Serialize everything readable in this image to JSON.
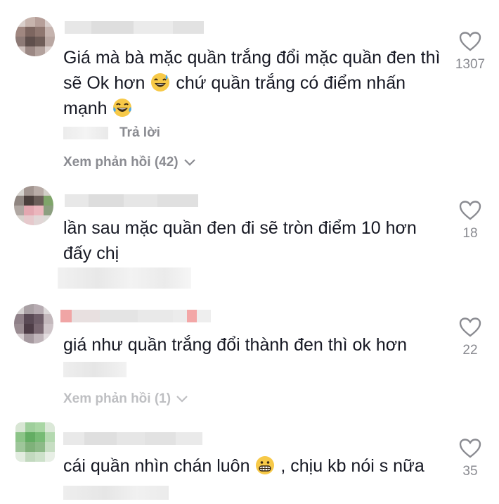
{
  "comments": [
    {
      "text_parts": [
        "Giá mà bà mặc quần trắng đổi mặc quần đen thì sẽ Ok hơn ",
        " chứ quần trắng có điểm nhấn mạnh "
      ],
      "emoji": [
        "grinning-sweat-emoji",
        "tears-of-joy-emoji"
      ],
      "reply_label": "Trả lời",
      "view_replies": "Xem phản hồi (42)",
      "likes": "1307",
      "heart_icon": "heart-outline-icon"
    },
    {
      "text": "lần sau mặc quần đen đi sẽ tròn điểm 10 hơn đấy chị",
      "likes": "18",
      "heart_icon": "heart-outline-icon"
    },
    {
      "text": "giá như quần trắng đổi thành đen thì ok hơn",
      "view_replies": "Xem phản hồi (1)",
      "likes": "22",
      "heart_icon": "heart-outline-icon"
    },
    {
      "text_parts": [
        "cái quần nhìn chán luôn ",
        " , chịu kb nói s nữa"
      ],
      "emoji": [
        "grimacing-emoji"
      ],
      "likes": "35",
      "heart_icon": "heart-outline-icon"
    }
  ],
  "colors": {
    "text": "#161823",
    "secondary": "#8a8b91",
    "background": "#ffffff"
  }
}
